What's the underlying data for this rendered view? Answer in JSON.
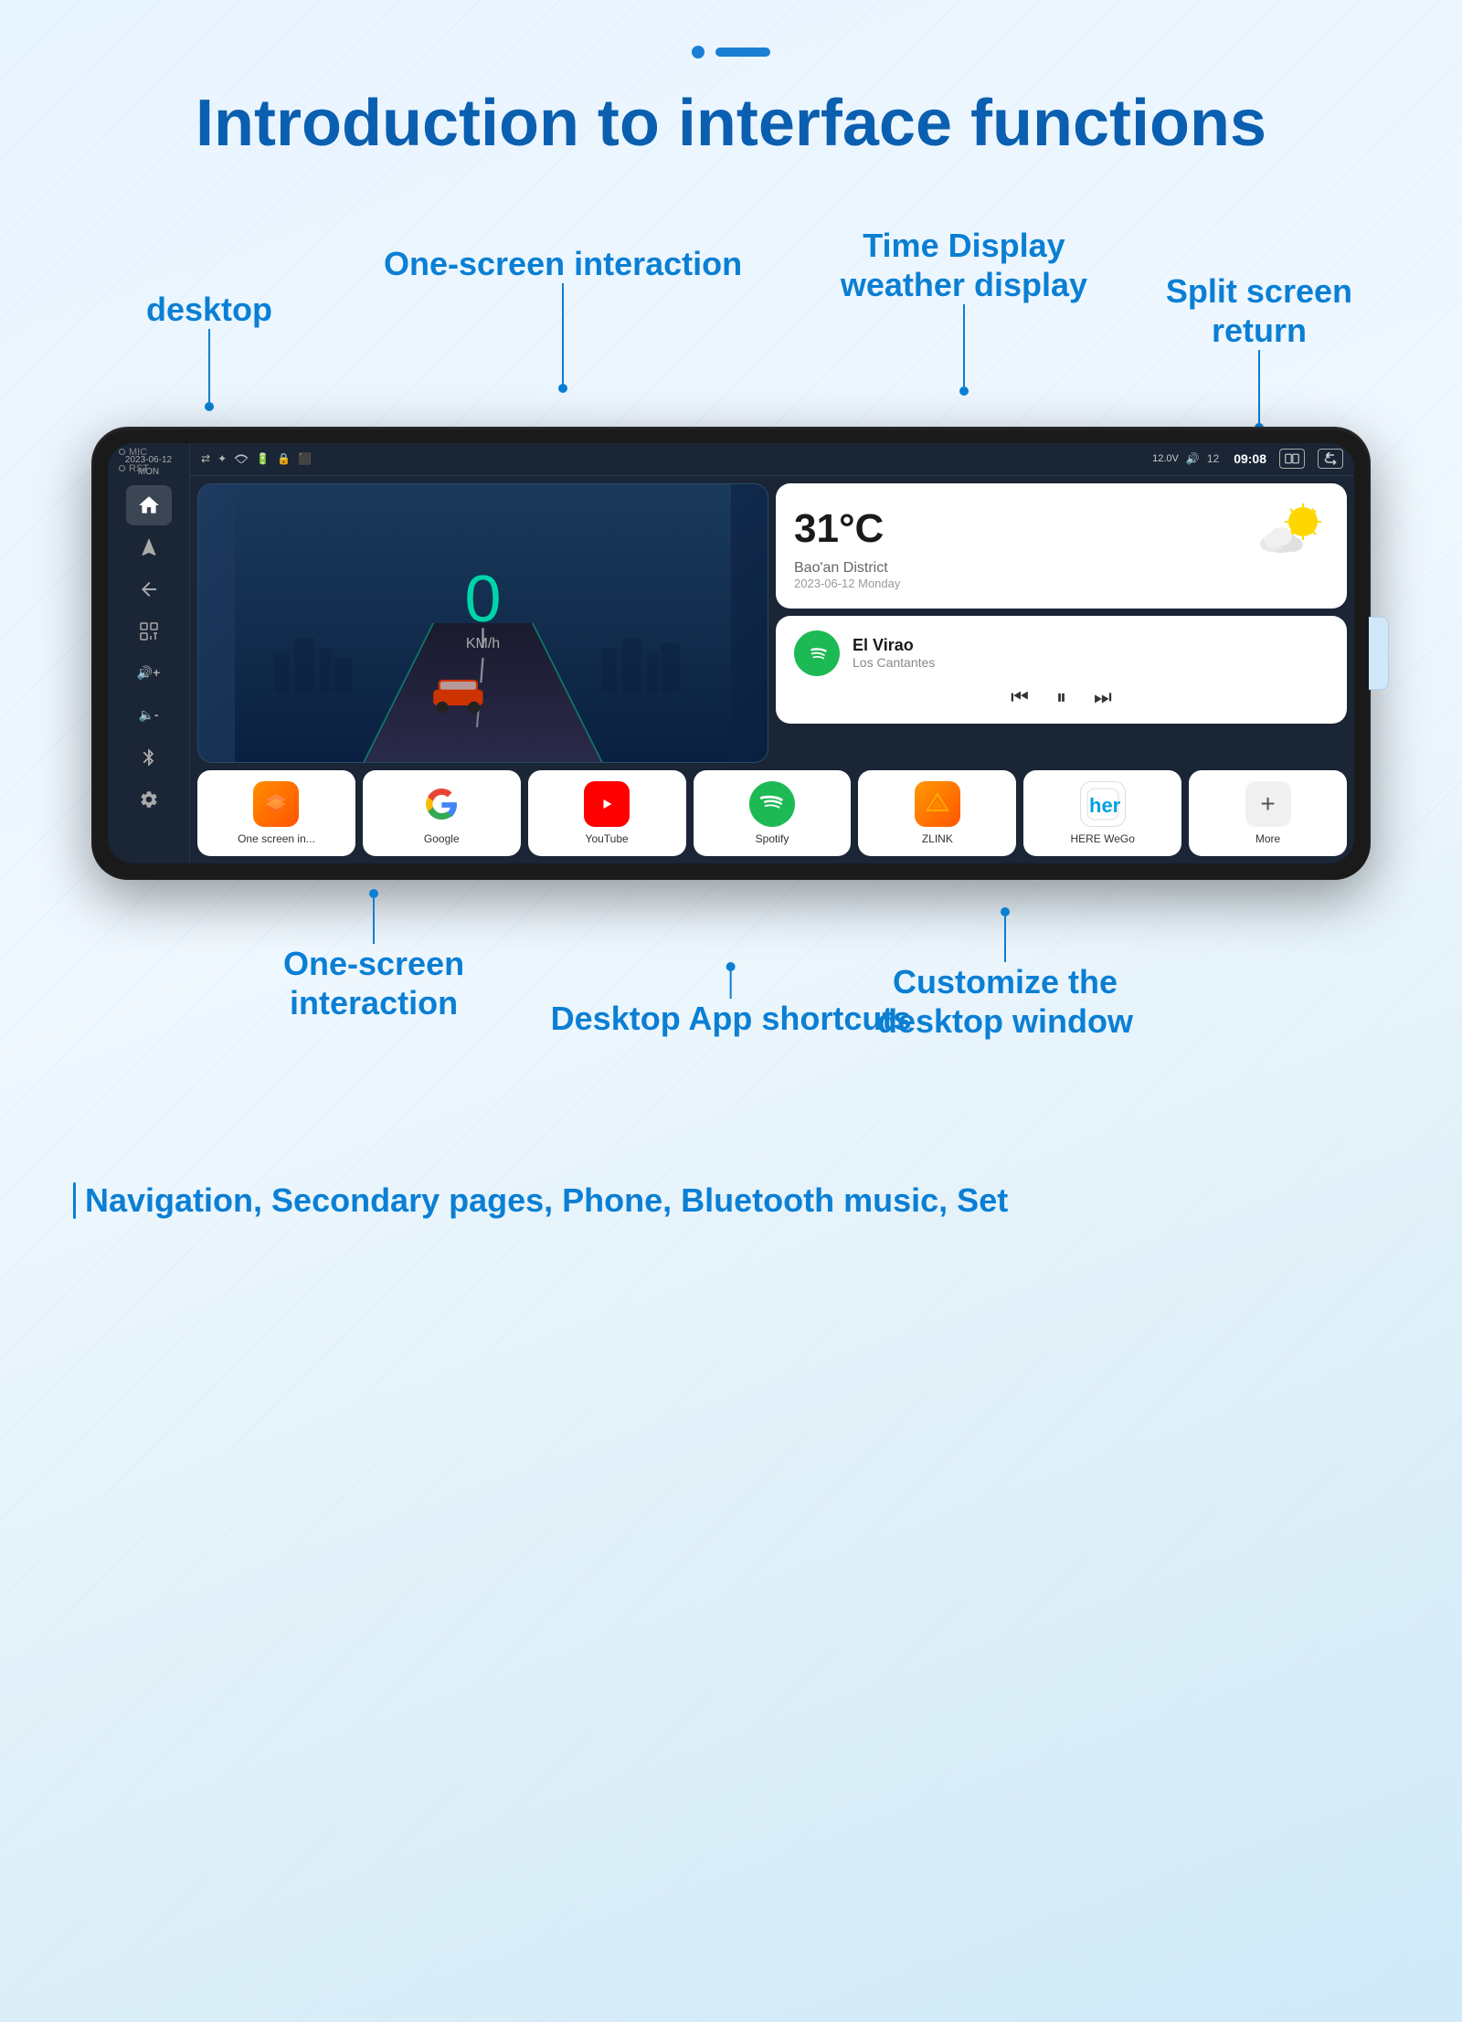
{
  "page": {
    "title": "Introduction to interface functions"
  },
  "top_indicator": {
    "dot": "•",
    "line": "—"
  },
  "annotations": {
    "desktop": "desktop",
    "one_screen_top": "One-screen interaction",
    "time_display": "Time Display\nweather display",
    "split_screen": "Split screen\nreturn",
    "one_screen_bottom": "One-screen\ninteraction",
    "customize": "Customize the\ndesktop window",
    "shortcuts": "Desktop App shortcuts",
    "nav": "Navigation, Secondary pages, Phone, Bluetooth music, Set"
  },
  "device": {
    "status_bar": {
      "time": "09:08",
      "voltage": "12.0V",
      "battery": "12",
      "icons": [
        "⇄",
        "✦",
        "WiFi",
        "⬜",
        "🔒",
        "⬜"
      ]
    },
    "sidebar": {
      "mic_label": "MIC",
      "rst_label": "RST",
      "date": "2023-06-12\nMON",
      "icons": [
        "home",
        "nav",
        "back",
        "apps",
        "vol_up",
        "vol_down",
        "bluetooth",
        "settings"
      ]
    },
    "speed_widget": {
      "speed": "0",
      "unit": "KM/h"
    },
    "weather_widget": {
      "temperature": "31°C",
      "location": "Bao'an District",
      "date": "2023-06-12 Monday"
    },
    "music_widget": {
      "song": "El Virao",
      "artist": "Los Cantantes",
      "controls": [
        "⏮",
        "⏸",
        "⏭"
      ]
    },
    "apps": [
      {
        "label": "One screen in...",
        "icon_type": "layers"
      },
      {
        "label": "Google",
        "icon_type": "google"
      },
      {
        "label": "YouTube",
        "icon_type": "youtube"
      },
      {
        "label": "Spotify",
        "icon_type": "spotify"
      },
      {
        "label": "ZLINK",
        "icon_type": "zlink"
      },
      {
        "label": "HERE WeGo",
        "icon_type": "here"
      },
      {
        "label": "More",
        "icon_type": "more"
      }
    ]
  }
}
